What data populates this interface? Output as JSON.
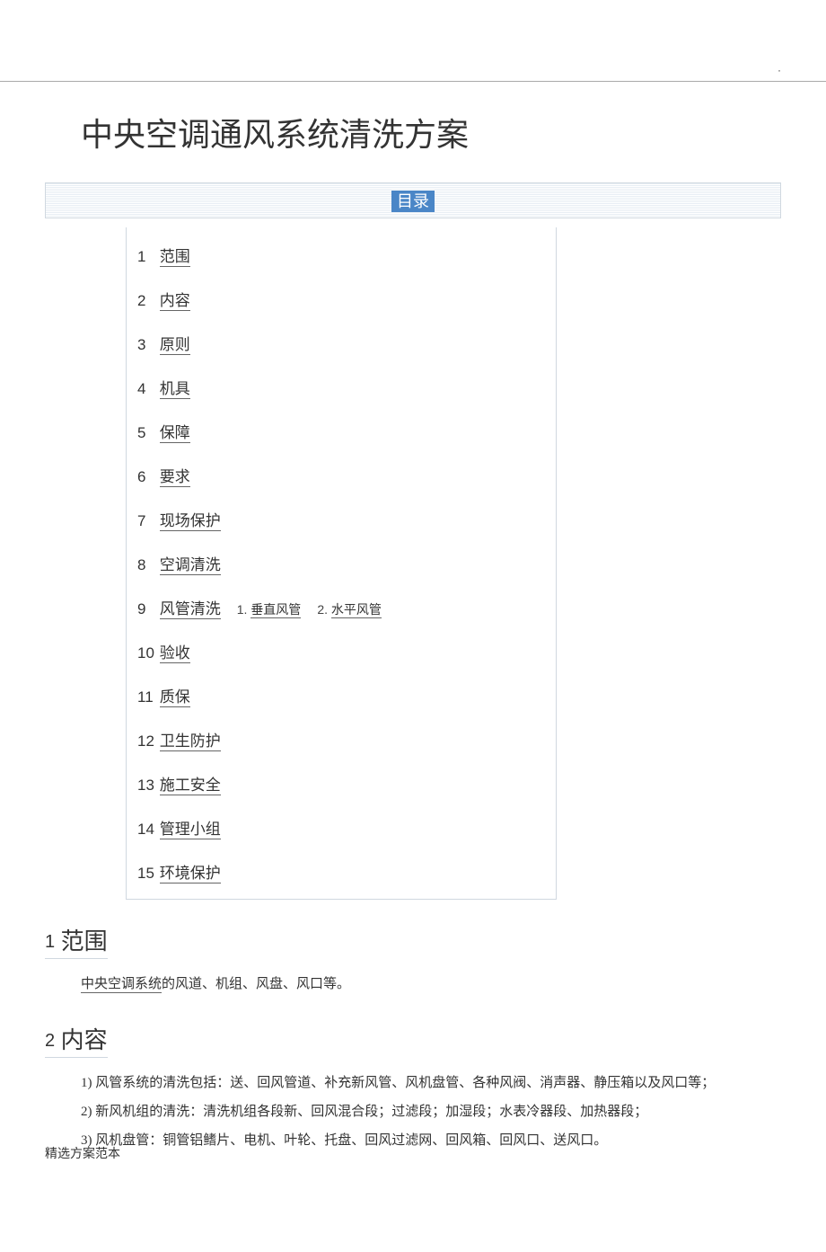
{
  "top_corner": "·",
  "title": "中央空调通风系统清洗方案",
  "toc_label": "目录",
  "toc": [
    {
      "num": "1",
      "label": "范围"
    },
    {
      "num": "2",
      "label": "内容"
    },
    {
      "num": "3",
      "label": "原则"
    },
    {
      "num": "4",
      "label": "机具"
    },
    {
      "num": "5",
      "label": "保障"
    },
    {
      "num": "6",
      "label": "要求"
    },
    {
      "num": "7",
      "label": "现场保护"
    },
    {
      "num": "8",
      "label": "空调清洗"
    },
    {
      "num": "9",
      "label": "风管清洗",
      "subs": [
        {
          "num": "1.",
          "label": "垂直风管"
        },
        {
          "num": "2.",
          "label": "水平风管"
        }
      ]
    },
    {
      "num": "10",
      "label": "验收"
    },
    {
      "num": "11",
      "label": "质保"
    },
    {
      "num": "12",
      "label": "卫生防护"
    },
    {
      "num": "13",
      "label": "施工安全"
    },
    {
      "num": "14",
      "label": "管理小组"
    },
    {
      "num": "15",
      "label": "环境保护"
    }
  ],
  "sections": {
    "s1": {
      "num": "1",
      "heading": "范围",
      "line1_linked": "中央空调系统",
      "line1_rest": "的风道、机组、风盘、风口等。"
    },
    "s2": {
      "num": "2",
      "heading": "内容",
      "p1": "1) 风管系统的清洗包括：送、回风管道、补充新风管、风机盘管、各种风阀、消声器、静压箱以及风口等；",
      "p2": "2) 新风机组的清洗：清洗机组各段新、回风混合段；过滤段；加湿段；水表冷器段、加热器段；",
      "p3": "3) 风机盘管：铜管铝鳍片、电机、叶轮、托盘、回风过滤网、回风箱、回风口、送风口。"
    }
  },
  "footer": "精选方案范本"
}
